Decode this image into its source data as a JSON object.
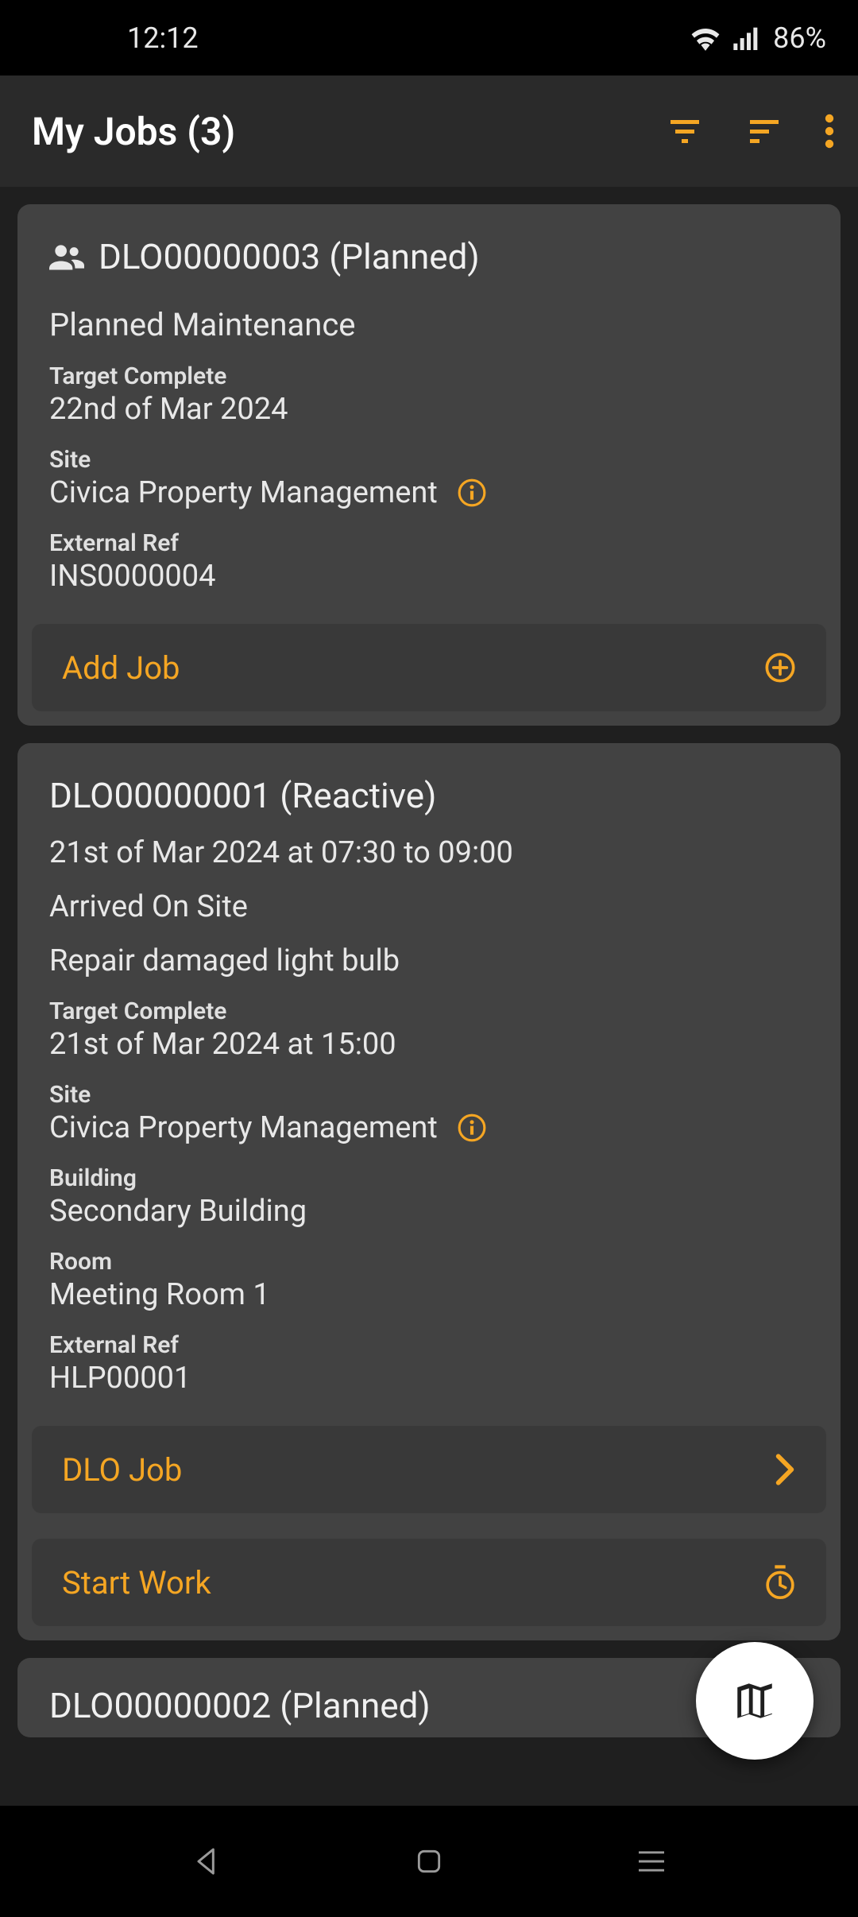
{
  "status": {
    "time": "12:12",
    "battery": "86%"
  },
  "appbar": {
    "title": "My Jobs (3)"
  },
  "colors": {
    "accent": "#f5a623"
  },
  "jobs": [
    {
      "icon": "people",
      "title": "DLO00000003 (Planned)",
      "description": "Planned Maintenance",
      "target_label": "Target Complete",
      "target_value": "22nd of Mar 2024",
      "site_label": "Site",
      "site_value": "Civica Property Management",
      "extref_label": "External Ref",
      "extref_value": "INS0000004",
      "actions": [
        {
          "label": "Add Job",
          "icon": "plus-circle"
        }
      ]
    },
    {
      "title": "DLO00000001 (Reactive)",
      "timerange": "21st of Mar 2024 at 07:30 to 09:00",
      "status": "Arrived On Site",
      "description": "Repair damaged light bulb",
      "target_label": "Target Complete",
      "target_value": "21st of Mar 2024 at 15:00",
      "site_label": "Site",
      "site_value": "Civica Property Management",
      "building_label": "Building",
      "building_value": "Secondary Building",
      "room_label": "Room",
      "room_value": "Meeting Room 1",
      "extref_label": "External Ref",
      "extref_value": "HLP00001",
      "actions": [
        {
          "label": "DLO Job",
          "icon": "chevron-right"
        },
        {
          "label": "Start Work",
          "icon": "timer"
        }
      ]
    },
    {
      "title": "DLO00000002 (Planned)"
    }
  ]
}
